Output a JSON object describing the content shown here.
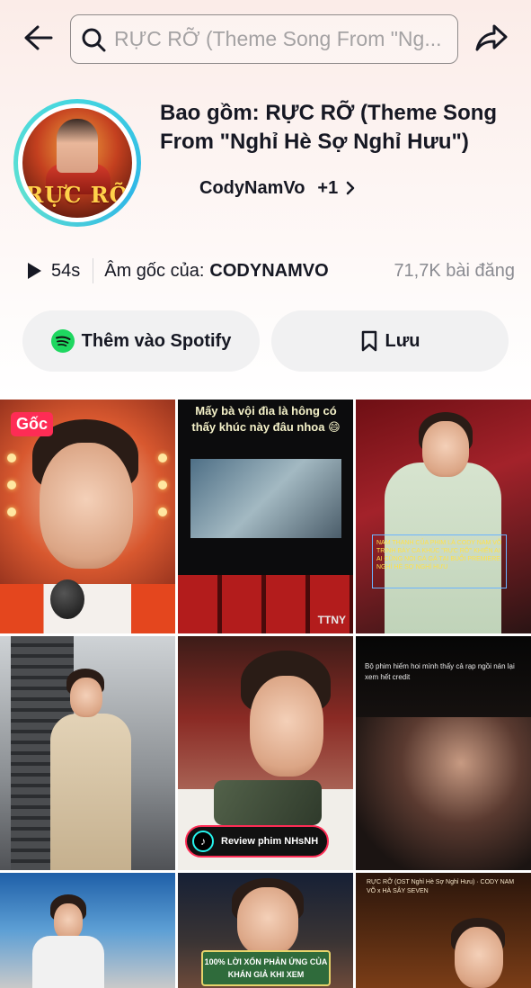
{
  "header": {
    "search_text": "RỰC RỠ (Theme Song From \"Ng...",
    "back_icon": "arrow-left-icon",
    "search_icon": "search-icon",
    "share_icon": "share-arrow-icon"
  },
  "sound": {
    "title": "Bao gồm: RỰC RỠ (Theme Song From \"Nghỉ Hè Sợ Nghỉ Hưu\")",
    "author": "CodyNamVo",
    "author_more": "+1",
    "cover_title": "RỰC RỠ",
    "duration": "54s",
    "original_label": "Âm gốc của:",
    "original_name": "CODYNAMVO",
    "posts": "71,7K bài đăng"
  },
  "actions": {
    "spotify_label": "Thêm vào Spotify",
    "save_label": "Lưu"
  },
  "grid": {
    "original_badge": "Gốc",
    "tile2_caption": "Mấy bà vội đìa là hông có thấy khúc này đâu nhoa 😄",
    "tile2_watermark": "TTNY",
    "tile3_caption": "NAM THANH CỦA PHIM LÀ CODY NAM VÕ TRÌNH BÀY CA KHÚC \"RỰC RỠ\" KHIẾN AI AI CŨNG NÓI GÀ GÀ TẠI BUỔI PREMIERE NGHỈ HÈ SỢ NGHỈ HƯU",
    "tile5_badge": "Review phim NHsNH",
    "tile6_caption": "Bộ phim hiếm hoi mình thấy cả rạp ngồi nán lại xem hết credit",
    "tile8_caption": "100% LỜI XỔN PHẢN ỨNG CỦA KHÁN GIẢ KHI XEM",
    "tile9_caption": "RỰC RỠ (OST Nghỉ Hè Sợ Nghỉ Hưu) · CODY NAM VÕ x HÀ SÂY SEVEN"
  },
  "colors": {
    "accent": "#fe2c55",
    "spotify": "#1ed760",
    "text_primary": "#161823",
    "text_secondary": "#8a8b91",
    "button_bg": "#f1f1f2"
  }
}
